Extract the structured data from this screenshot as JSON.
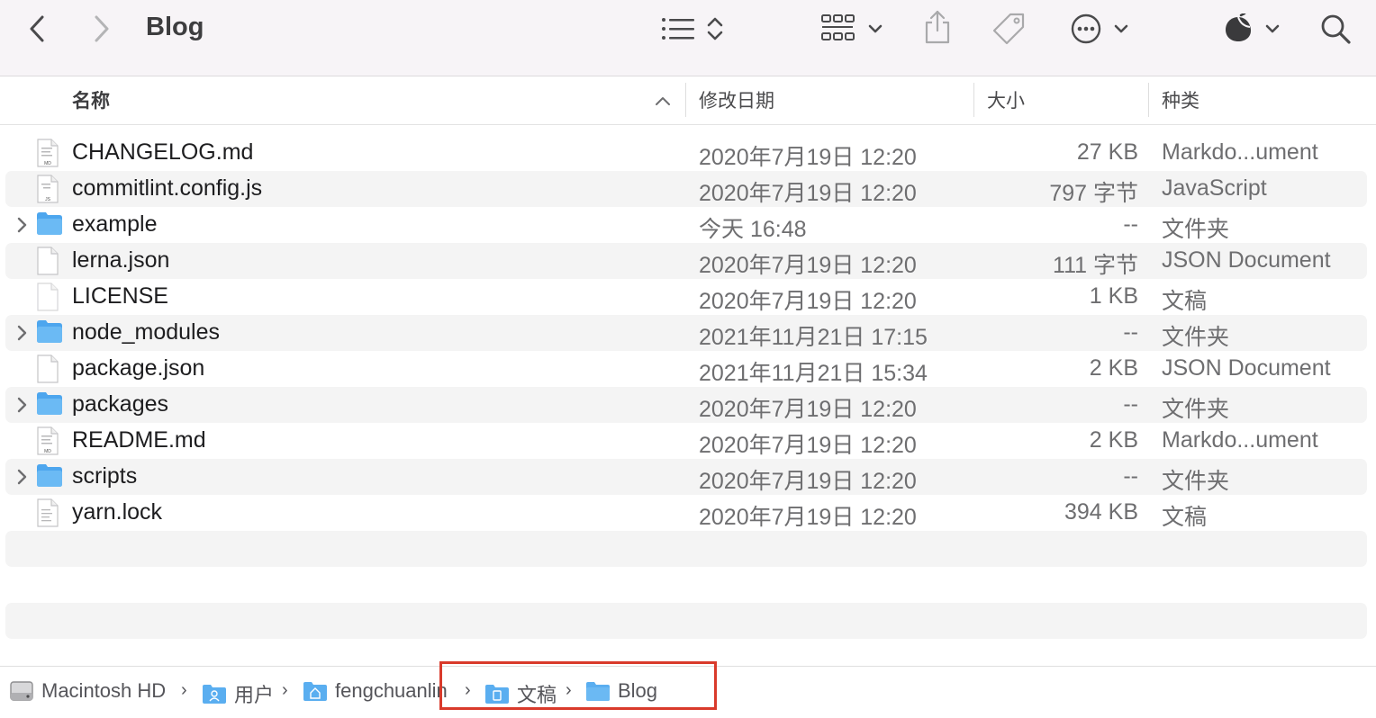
{
  "window": {
    "title": "Blog"
  },
  "toolbar": {
    "back_icon": "chevron-left-icon",
    "forward_icon": "chevron-right-icon",
    "list_view_icon": "list-view-icon",
    "sort_icon": "up-down-chevron-icon",
    "grid_view_icon": "grid-view-icon",
    "share_icon": "share-icon",
    "tag_icon": "tag-icon",
    "more_icon": "ellipsis-circle-icon",
    "app_icon": "dark-leaf-icon",
    "search_icon": "search-icon"
  },
  "columns": {
    "name": "名称",
    "date": "修改日期",
    "size": "大小",
    "kind": "种类"
  },
  "files": [
    {
      "name": "CHANGELOG.md",
      "date": "2020年7月19日 12:20",
      "size": "27 KB",
      "kind": "Markdo...ument",
      "type": "md",
      "folder": false
    },
    {
      "name": "commitlint.config.js",
      "date": "2020年7月19日 12:20",
      "size": "797 字节",
      "kind": "JavaScript",
      "type": "js",
      "folder": false
    },
    {
      "name": "example",
      "date": "今天 16:48",
      "size": "--",
      "kind": "文件夹",
      "type": "folder",
      "folder": true
    },
    {
      "name": "lerna.json",
      "date": "2020年7月19日 12:20",
      "size": "111 字节",
      "kind": "JSON Document",
      "type": "blank",
      "folder": false
    },
    {
      "name": "LICENSE",
      "date": "2020年7月19日 12:20",
      "size": "1 KB",
      "kind": "文稿",
      "type": "plain",
      "folder": false
    },
    {
      "name": "node_modules",
      "date": "2021年11月21日 17:15",
      "size": "--",
      "kind": "文件夹",
      "type": "folder",
      "folder": true
    },
    {
      "name": "package.json",
      "date": "2021年11月21日 15:34",
      "size": "2 KB",
      "kind": "JSON Document",
      "type": "blank",
      "folder": false
    },
    {
      "name": "packages",
      "date": "2020年7月19日 12:20",
      "size": "--",
      "kind": "文件夹",
      "type": "folder",
      "folder": true
    },
    {
      "name": "README.md",
      "date": "2020年7月19日 12:20",
      "size": "2 KB",
      "kind": "Markdo...ument",
      "type": "md",
      "folder": false
    },
    {
      "name": "scripts",
      "date": "2020年7月19日 12:20",
      "size": "--",
      "kind": "文件夹",
      "type": "folder",
      "folder": true
    },
    {
      "name": "yarn.lock",
      "date": "2020年7月19日 12:20",
      "size": "394 KB",
      "kind": "文稿",
      "type": "text",
      "folder": false
    }
  ],
  "pathbar": {
    "items": [
      {
        "label": "Macintosh HD",
        "icon": "hard-drive-icon"
      },
      {
        "label": "用户",
        "icon": "users-folder-icon"
      },
      {
        "label": "fengchuanlin",
        "icon": "home-folder-icon"
      },
      {
        "label": "文稿",
        "icon": "documents-folder-icon"
      },
      {
        "label": "Blog",
        "icon": "folder-icon"
      }
    ],
    "separator": "›"
  },
  "colors": {
    "folder": "#5aaef0",
    "highlight": "#d93a2b",
    "toolbar_bg": "#f7f4f7",
    "row_alt": "#f4f4f4"
  }
}
